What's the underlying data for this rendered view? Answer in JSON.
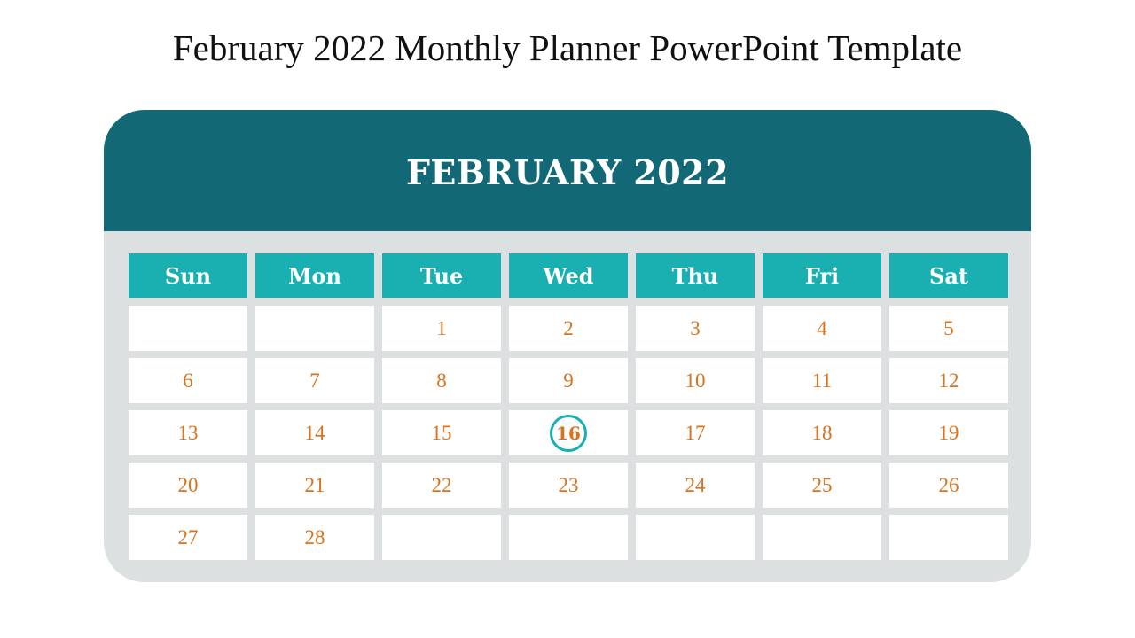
{
  "slide": {
    "title": "February 2022 Monthly Planner PowerPoint Template"
  },
  "calendar": {
    "month_title": "FEBRUARY 2022",
    "weekdays": [
      "Sun",
      "Mon",
      "Tue",
      "Wed",
      "Thu",
      "Fri",
      "Sat"
    ],
    "weeks": [
      [
        "",
        "",
        "1",
        "2",
        "3",
        "4",
        "5"
      ],
      [
        "6",
        "7",
        "8",
        "9",
        "10",
        "11",
        "12"
      ],
      [
        "13",
        "14",
        "15",
        "16",
        "17",
        "18",
        "19"
      ],
      [
        "20",
        "21",
        "22",
        "23",
        "24",
        "25",
        "26"
      ],
      [
        "27",
        "28",
        "",
        "",
        "",
        "",
        ""
      ]
    ],
    "highlighted_day": "16",
    "colors": {
      "header": "#136876",
      "weekday_header": "#1aafb0",
      "panel": "#dce0e1",
      "date_text": "#d8731f",
      "highlight_ring": "#1aafb0"
    }
  }
}
